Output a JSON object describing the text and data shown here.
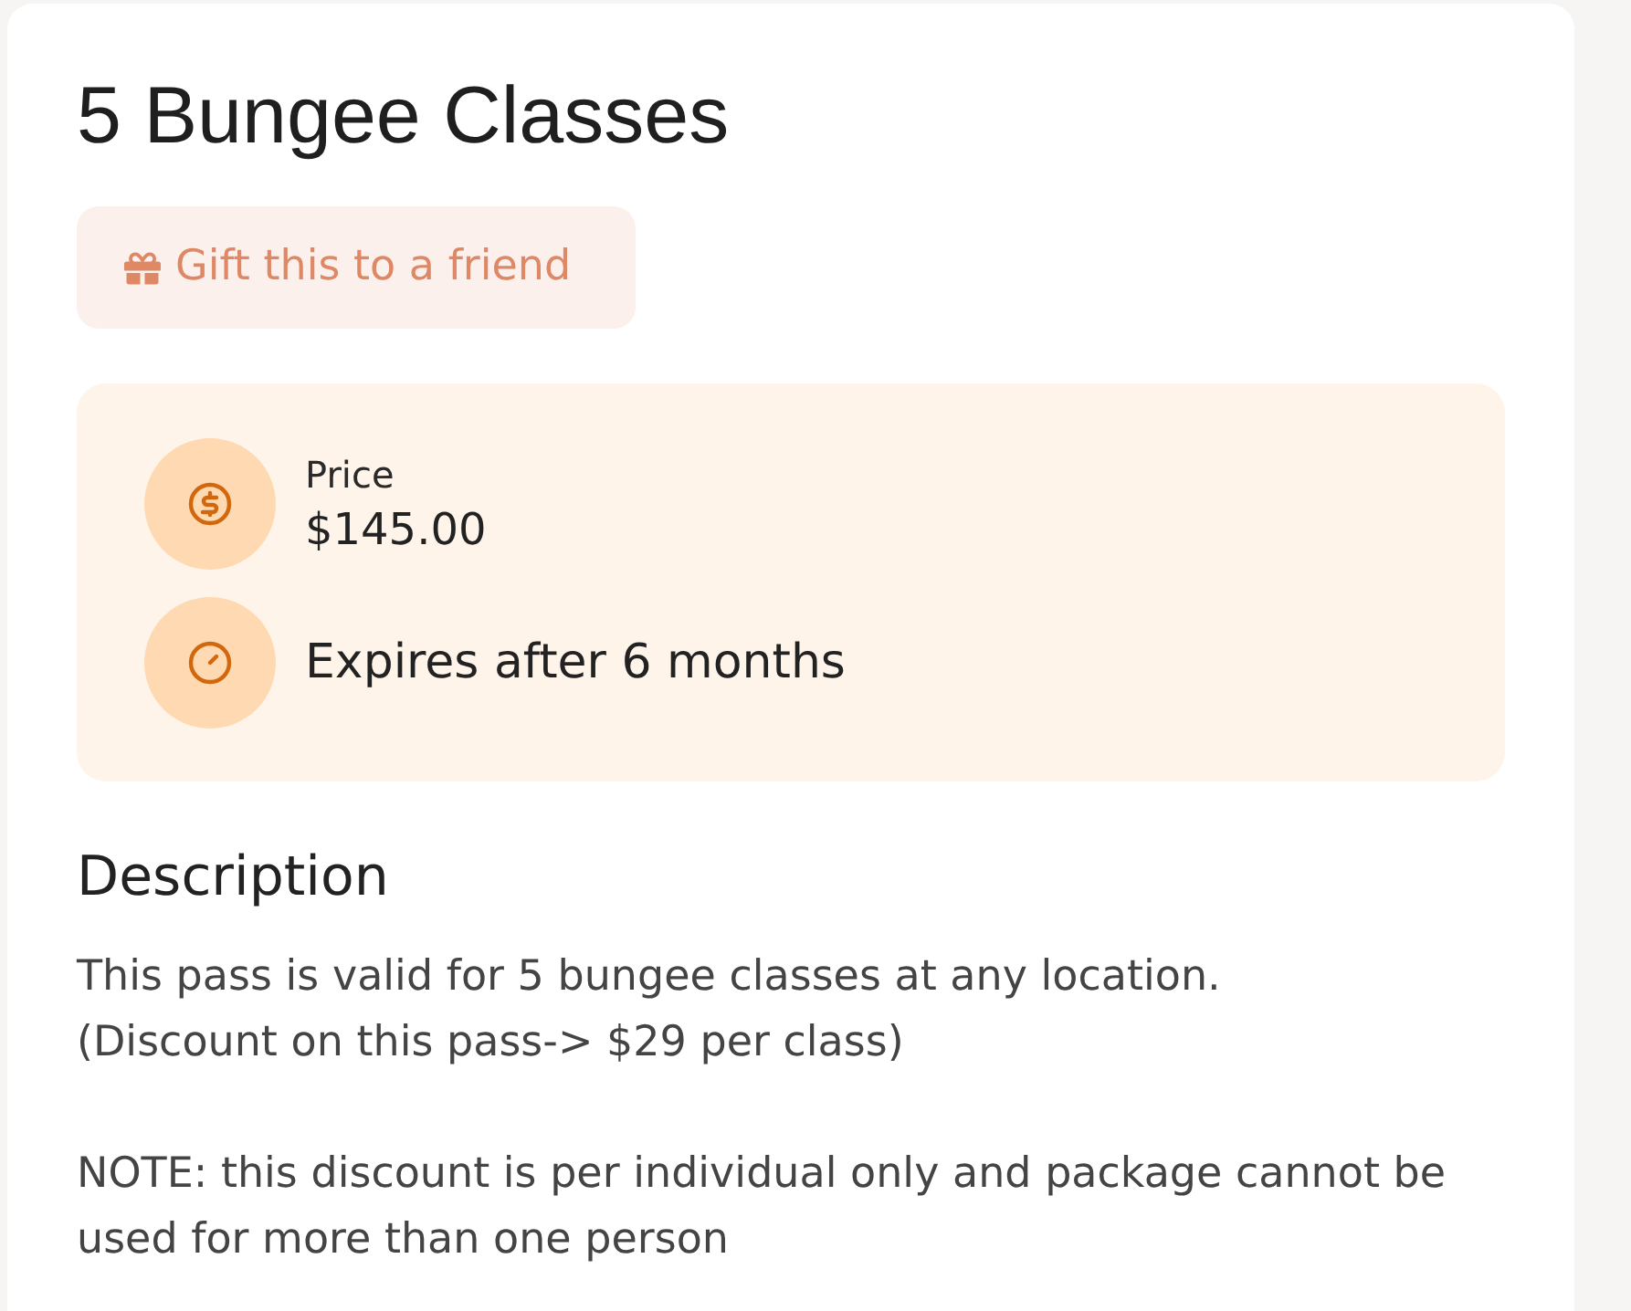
{
  "title": "5 Bungee Classes",
  "gift_button": {
    "label": "Gift this to a friend"
  },
  "details": [
    {
      "kind": "price",
      "label": "Price",
      "value": "$145.00"
    },
    {
      "kind": "expiry",
      "value": "Expires after 6 months"
    }
  ],
  "description": {
    "heading": "Description",
    "text": "This pass is valid for 5 bungee classes at any location.\n(Discount on this pass-> $29 per class)\n\nNOTE: this discount is per individual only and package cannot be used for more than one person"
  }
}
